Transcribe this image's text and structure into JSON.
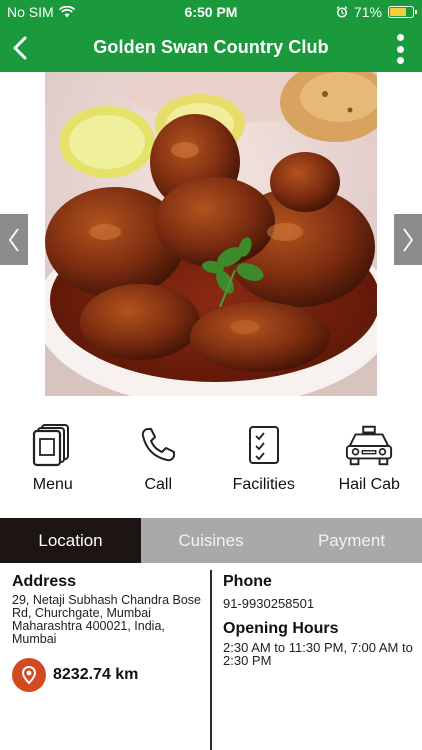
{
  "status_bar": {
    "carrier": "No SIM",
    "time": "6:50 PM",
    "battery": "71%",
    "battery_level": 0.71
  },
  "nav": {
    "title": "Golden Swan Country Club"
  },
  "actions": [
    {
      "label": "Menu"
    },
    {
      "label": "Call"
    },
    {
      "label": "Facilities"
    },
    {
      "label": "Hail Cab"
    }
  ],
  "tabs": [
    {
      "label": "Location",
      "active": true
    },
    {
      "label": "Cuisines",
      "active": false
    },
    {
      "label": "Payment",
      "active": false
    }
  ],
  "address": {
    "heading": "Address",
    "text": "29, Netaji Subhash Chandra Bose Rd,  Churchgate, Mumbai Maharashtra 400021, India, Mumbai",
    "distance": "8232.74 km"
  },
  "phone": {
    "heading": "Phone",
    "number": "91-9930258501"
  },
  "hours": {
    "heading": "Opening Hours",
    "text": " 2:30 AM to 11:30 PM,  7:00 AM to  2:30 PM"
  },
  "colors": {
    "brand_green": "#1a9a3c",
    "tab_active": "#1c1513",
    "tab_inactive": "#a9a9a9",
    "pin_orange": "#d24a1f"
  }
}
